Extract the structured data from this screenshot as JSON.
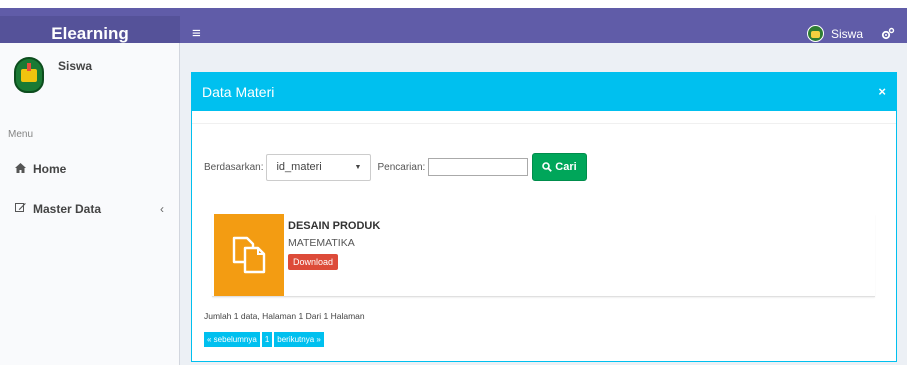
{
  "navbar": {
    "logo": "Elearning",
    "menu_toggle": "≡",
    "user_name": "Siswa",
    "settings_icon": "gears-icon"
  },
  "sidebar": {
    "user_name": "Siswa",
    "menu_header": "Menu",
    "items": [
      {
        "label": "Home",
        "icon": "home-icon"
      },
      {
        "label": "Master Data",
        "icon": "edit-icon",
        "chevron": "‹"
      }
    ]
  },
  "box": {
    "title": "Data Materi",
    "close": "×"
  },
  "search": {
    "by_label": "Berdasarkan:",
    "by_value": "id_materi",
    "query_label": "Pencarian:",
    "query_value": "",
    "button_label": "Cari"
  },
  "items": [
    {
      "title": "DESAIN PRODUK",
      "subject": "MATEMATIKA",
      "action": "Download",
      "icon_color": "#f39c12"
    }
  ],
  "footer": {
    "info": "Jumlah 1 data, Halaman 1 Dari 1 Halaman",
    "prev": "« sebelumnya",
    "page": "1",
    "next": "berikutnya »"
  },
  "colors": {
    "navbar": "#605ca8",
    "logo_bg": "#555299",
    "box_accent": "#00c0ef",
    "search_button": "#00a65a",
    "download_button": "#dd4b39"
  }
}
